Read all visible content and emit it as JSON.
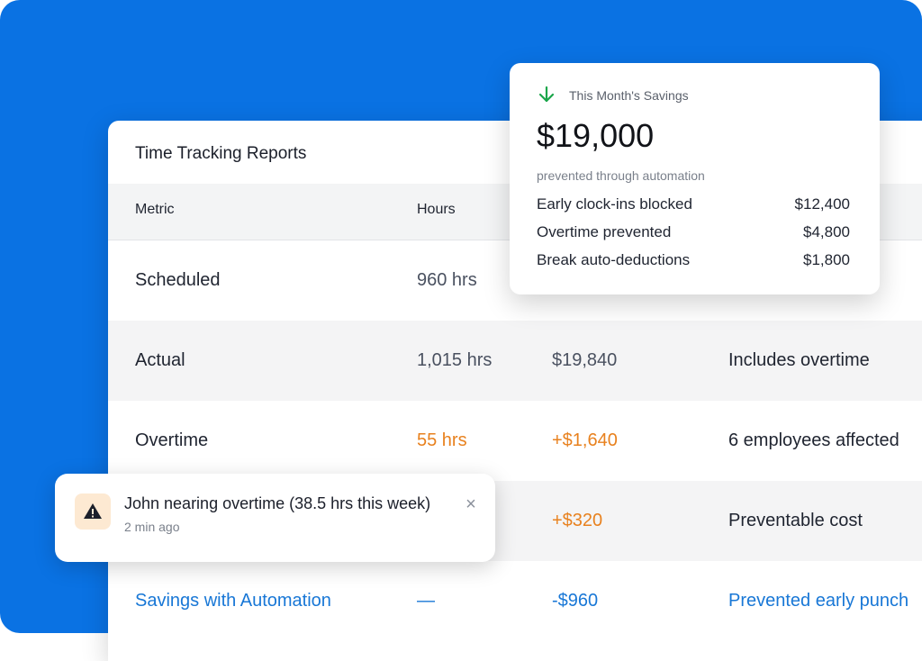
{
  "report": {
    "title": "Time Tracking Reports",
    "headers": {
      "metric": "Metric",
      "hours": "Hours"
    },
    "rows": [
      {
        "metric": "Scheduled",
        "hours": "960 hrs",
        "cost": "",
        "note": ""
      },
      {
        "metric": "Actual",
        "hours": "1,015 hrs",
        "cost": "$19,840",
        "note": "Includes overtime"
      },
      {
        "metric": "Overtime",
        "hours": "55 hrs",
        "cost": "+$1,640",
        "note": "6 employees affected"
      },
      {
        "metric": "",
        "hours": "",
        "cost": "+$320",
        "note": "Preventable cost"
      },
      {
        "metric": "Savings with Automation",
        "hours": "—",
        "cost": "-$960",
        "note": "Prevented early punch"
      }
    ]
  },
  "savings": {
    "arrow_icon": "arrow-down-icon",
    "label": "This Month's Savings",
    "amount": "$19,000",
    "subtitle": "prevented through automation",
    "items": [
      {
        "label": "Early clock-ins blocked",
        "value": "$12,400"
      },
      {
        "label": "Overtime prevented",
        "value": "$4,800"
      },
      {
        "label": "Break auto-deductions",
        "value": "$1,800"
      }
    ]
  },
  "toast": {
    "icon": "warning-icon",
    "title": "John nearing overtime (38.5 hrs this week)",
    "time": "2 min ago",
    "close_glyph": "×"
  },
  "colors": {
    "background_blue": "#0a72e3",
    "accent_orange": "#e8811e",
    "accent_blue": "#1877d6",
    "savings_green": "#1aa64a"
  }
}
